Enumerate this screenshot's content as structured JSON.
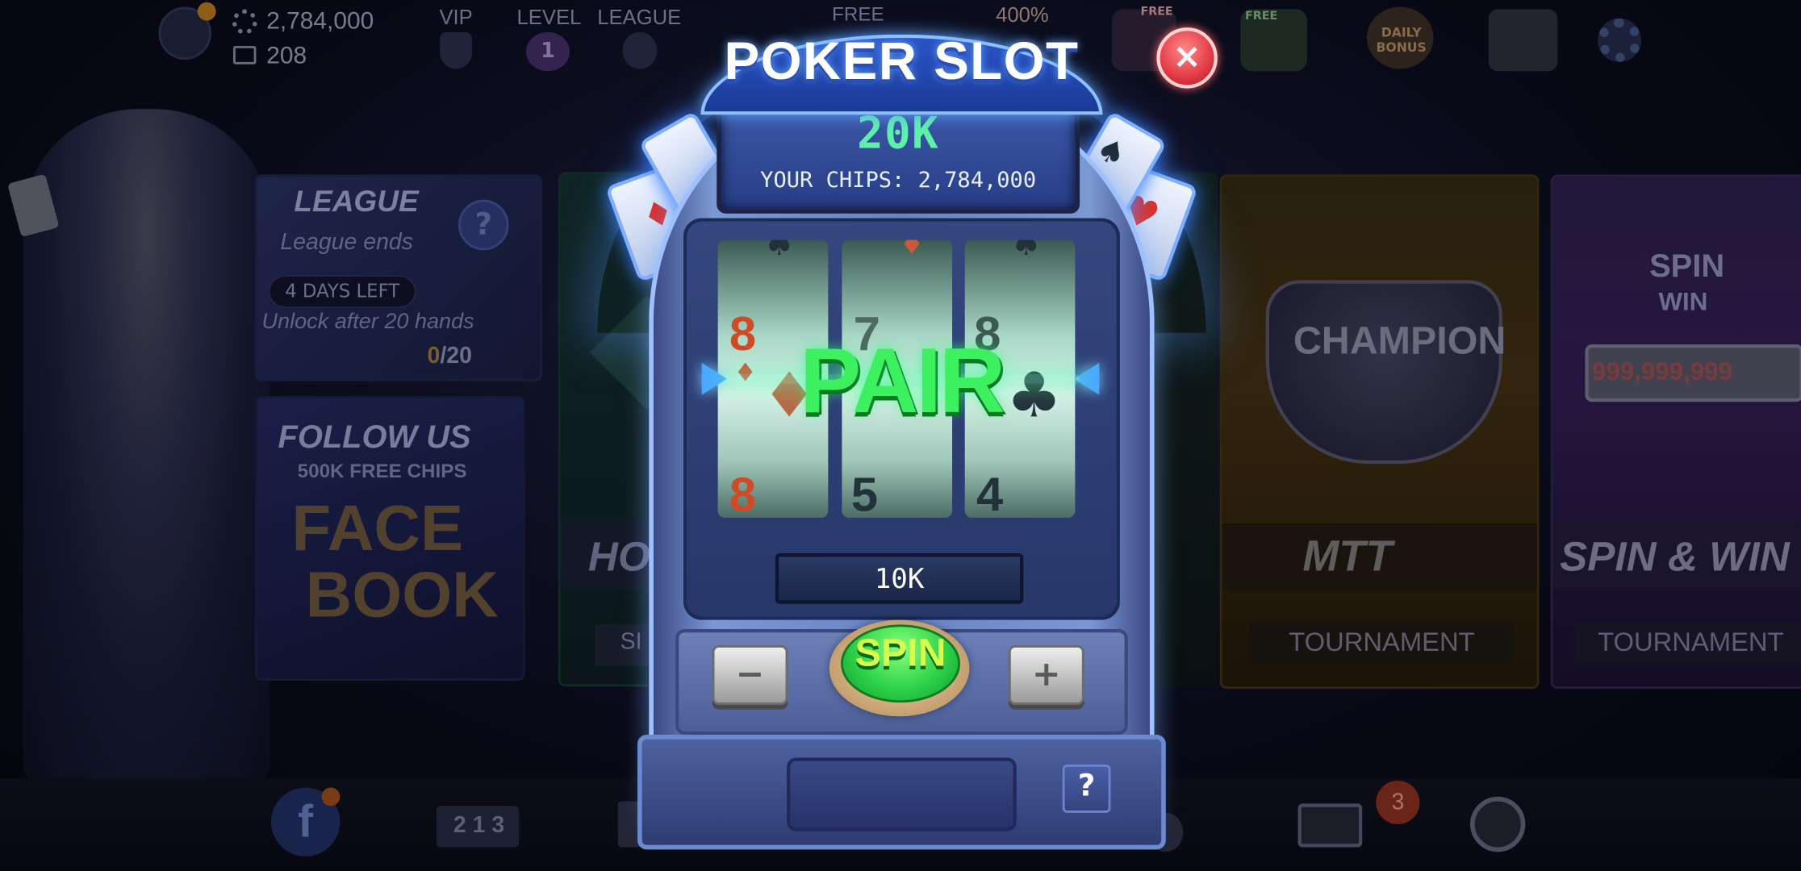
{
  "topbar": {
    "chips": "2,784,000",
    "gems": "208",
    "vip_label": "VIP",
    "level_label": "LEVEL",
    "level_value": "1",
    "league_label": "LEAGUE",
    "free_label": "FREE",
    "bonus_percent": "400%",
    "free_badge_1": "FREE",
    "free_badge_2": "FREE",
    "daily_bonus_label": "DAILY BONUS"
  },
  "panels": {
    "league": {
      "title": "LEAGUE",
      "subtitle": "League ends",
      "days_left": "4 DAYS LEFT",
      "unlock_text": "Unlock after 20 hands",
      "progress_current": "0",
      "progress_total": "/20"
    },
    "follow": {
      "title": "FOLLOW US",
      "subtitle": "500K FREE CHIPS",
      "brand_line1": "FACE",
      "brand_line2": "BOOK"
    },
    "hold": {
      "title": "HO",
      "subtitle": "SI"
    },
    "mtt": {
      "title": "MTT",
      "subtitle": "TOURNAMENT",
      "badge": "CHAMPION"
    },
    "spin_win": {
      "title": "SPIN & WIN",
      "subtitle": "TOURNAMENT",
      "amount": "999,999,999",
      "logo_top": "SPIN",
      "logo_bottom": "WIN"
    }
  },
  "slot": {
    "title": "POKER SLOT",
    "prize": "20K",
    "your_chips": "YOUR CHIPS: 2,784,000",
    "result": "PAIR",
    "bet": "10K",
    "spin_label": "SPIN",
    "minus_label": "−",
    "plus_label": "+",
    "help_label": "?",
    "close_label": "×",
    "reels": [
      {
        "top": "8",
        "top_suit": "♦",
        "middle_suit": "♦",
        "bottom": "8"
      },
      {
        "top": "7",
        "middle_suit": "",
        "bottom": "5"
      },
      {
        "top": "8",
        "top_suit": "",
        "middle_suit": "♣",
        "bottom": "4"
      }
    ]
  },
  "bottombar": {
    "mail_badge": "3",
    "rank_digits": "2 1 3"
  },
  "colors": {
    "accent_green": "#2ed34a",
    "screen_text": "#5df0a8",
    "close_red": "#e23a46"
  }
}
